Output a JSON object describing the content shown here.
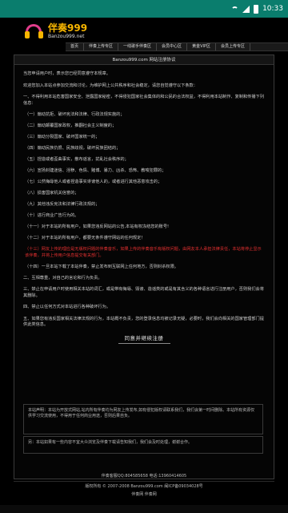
{
  "status_bar": {
    "time": "10:33"
  },
  "logo": {
    "name": "伴奏999",
    "domain": "Banzou999.net"
  },
  "nav": {
    "items": [
      "首页",
      "伴奏上传专区",
      "一线歌手伴奏区",
      "会员中心区",
      "黄金VIP区",
      "会员上传专区"
    ]
  },
  "panel": {
    "title": "Banzou999.com 网站注册协议"
  },
  "agreement": {
    "p1": "当您申请用户时，表示您已经同意遵守本规章。",
    "p2": "欢迎您加入本站点参加交流和讨论，为维护网上公共秩序和社会稳定，请您自觉遵守以下条款：",
    "p3": "一、不得利用本站危害国家安全、泄露国家秘密，不得侵犯国家社会集体的和公民的合法权益，不得利用本站制作、复制和传播下列信息：",
    "items": [
      "（一）煽动抗拒、破坏宪法和法律、行政法规实施的；",
      "（二）煽动颠覆国家政权，推翻社会主义制度的；",
      "（三）煽动分裂国家、破坏国家统一的；",
      "（四）煽动民族仇恨、民族歧视，破坏民族团结的；",
      "（五）捏造或者歪曲事实，散布谣言，扰乱社会秩序的；",
      "（六）宣扬封建迷信、淫秽、色情、赌博、暴力、凶杀、恐怖、教唆犯罪的；",
      "（七）公然侮辱他人或者捏造事实诽谤他人的，或者进行其他恶意攻击的；",
      "（八）损害国家机关信誉的；",
      "（九）其他违反宪法和法律行政法规的；",
      "（十）进行商业广告行为的。",
      "（十一）对于本站的所有用户，如果您违反网站的公告,本站有权冻结您的账号!",
      "（十二）对于本站的所有用户，都要无条件遵守网站的任何规定！"
    ],
    "item13": "（十三）网友上传的理应是无版权问题的伴奏音乐，如果上传的伴奏音乐有版权问题，由网友本人承担法律责任，本站将停止显示该伴奏，并将上传用户信息提交有关部门。",
    "item14": "（十四）一旦本站下载了本站伴奏，禁止发布到互联网上任何地方，否则封杀权限。",
    "p4": "二、互相尊重，对自己的言论和行为负责。",
    "p5": "三、禁止在申请用户时使用相关本站的词汇，或是带有侮辱、毁谤、造谣类的或是有其含义的各种语言进行注册用户，否则我们会将其删除。",
    "p6": "四、禁止以任何方式对本站进行各种破坏行为。",
    "p7": "五、如果您有违反国家相关法律法规的行为，本站概不负责，您的登录信息均被记录无疑，必要时，我们会向相关的国家管理部门提供此类信息。",
    "agree_button": "同意并继续注册"
  },
  "notices": {
    "n1": "本站声明：本站为开放式网站,站内所有伴奏均为网友上传发布,如有侵犯版权请联系我们，我们会第一时间删除。本站所有资源仅供学习交流使用，不得用于任何商业用途，否则后果自负。",
    "n2": "另：本站如果有一些内容不宜大众浏览及伴奏下载请告知我们，我们会及时处理，谢谢合作。"
  },
  "footer": {
    "line1": "伴奏客服QQ:804585658 电话:13960414605",
    "line2": "版权所有 © 2007-2008 Banzou999.com 闽ICP备09034028号",
    "line3": "伴奏网 伴奏网"
  }
}
